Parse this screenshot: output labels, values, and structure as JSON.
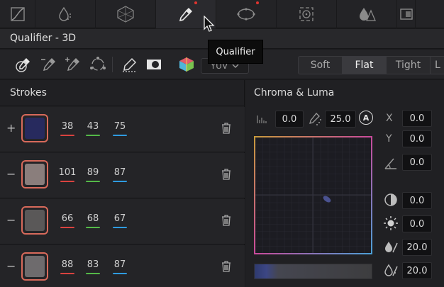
{
  "tooltip": "Qualifier",
  "panel_title": "Qualifier - 3D",
  "toolbar": {
    "colorspace": "YUV",
    "softness_options": [
      "Soft",
      "Flat",
      "Tight",
      "L"
    ],
    "selected_softness": "Flat"
  },
  "strokes": {
    "header": "Strokes",
    "rows": [
      {
        "sign": "+",
        "color": "#272a5e",
        "v1": "38",
        "v2": "43",
        "v3": "75"
      },
      {
        "sign": "−",
        "color": "#8a7e7c",
        "v1": "101",
        "v2": "89",
        "v3": "87"
      },
      {
        "sign": "−",
        "color": "#5a5858",
        "v1": "66",
        "v2": "68",
        "v3": "67"
      },
      {
        "sign": "−",
        "color": "#6e6b6d",
        "v1": "88",
        "v2": "83",
        "v3": "87"
      }
    ]
  },
  "chroma_luma": {
    "header": "Chroma & Luma",
    "low": "0.0",
    "high": "25.0",
    "badge": "A",
    "x_label": "X",
    "x_value": "0.0",
    "y_label": "Y",
    "y_value": "0.0",
    "angle_value": "0.0",
    "v4": "0.0",
    "v5": "0.0",
    "v6": "20.0",
    "v7": "20.0"
  },
  "colors": {
    "swatch_border": "#d86a5b",
    "channel_red": "#d9423f",
    "channel_green": "#54b948",
    "channel_blue": "#2f9be0"
  }
}
